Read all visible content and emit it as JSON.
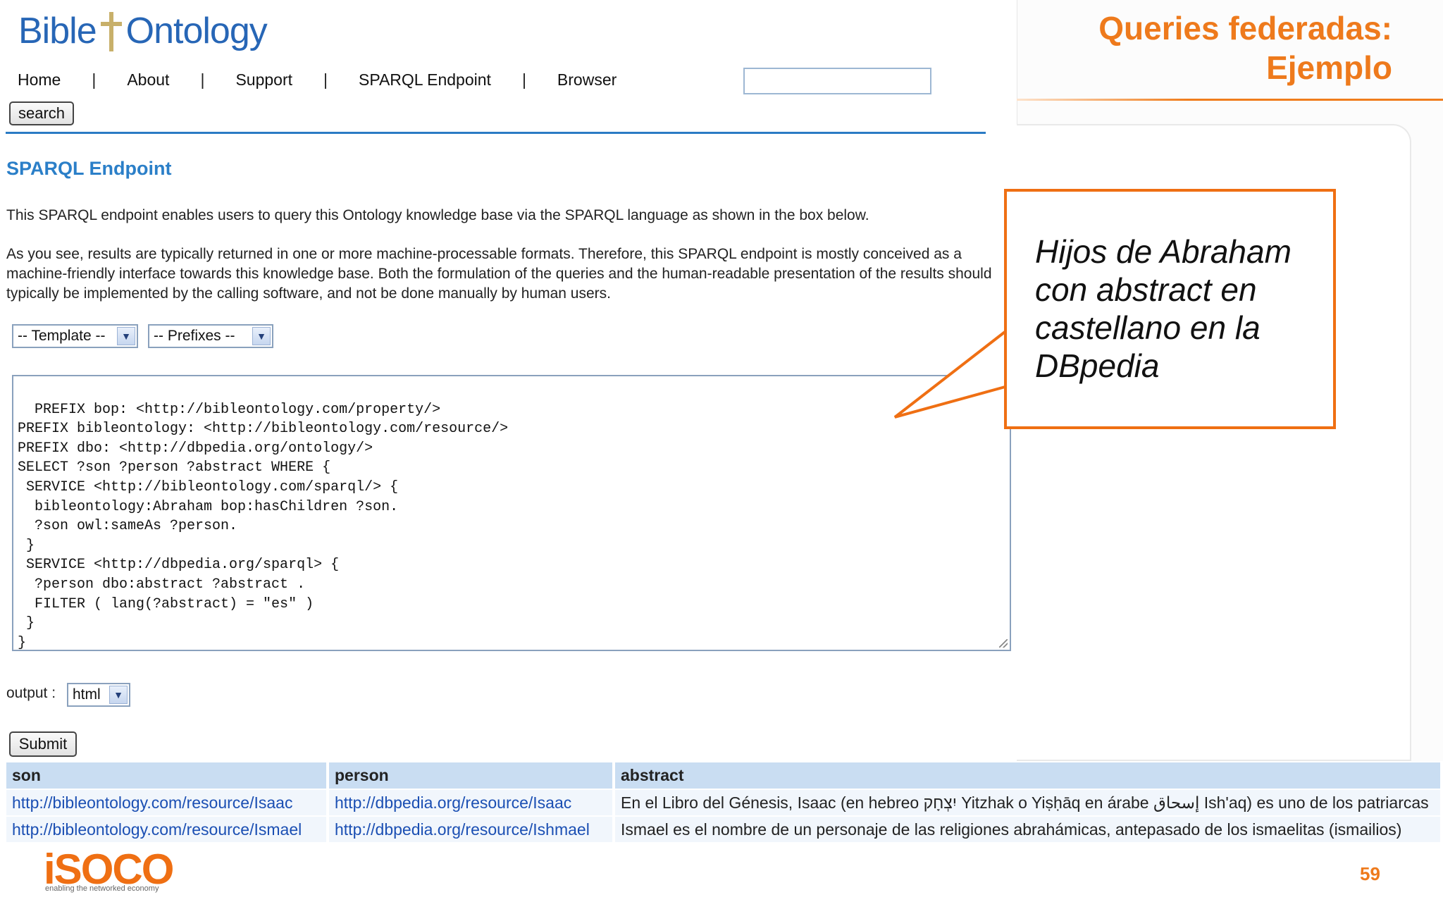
{
  "slide": {
    "title_line1": "Queries federadas:",
    "title_line2": "Ejemplo",
    "page_number": "59",
    "brand_logo": "iSOCO",
    "brand_tagline": "enabling the networked economy",
    "accent_color": "#ee7a1c"
  },
  "site": {
    "logo_left": "Bible",
    "logo_right": "Ontology",
    "nav": [
      "Home",
      "About",
      "Support",
      "SPARQL Endpoint",
      "Browser"
    ],
    "nav_separator": "|",
    "search_value": "",
    "search_button": "search",
    "heading": "SPARQL Endpoint",
    "paragraph1": "This SPARQL endpoint enables users to query this Ontology knowledge base via the SPARQL language as shown in the box below.",
    "paragraph2": "As you see, results are typically returned in one or more machine-processable formats. Therefore, this SPARQL endpoint is mostly conceived as a machine-friendly interface towards this knowledge base. Both the formulation of the queries and the human-readable presentation of the results should typically be implemented by the calling software, and not be done manually by human users.",
    "template_select": "-- Template --",
    "prefixes_select": "-- Prefixes --",
    "query": "PREFIX bop: <http://bibleontology.com/property/>\nPREFIX bibleontology: <http://bibleontology.com/resource/>\nPREFIX dbo: <http://dbpedia.org/ontology/>\nSELECT ?son ?person ?abstract WHERE {\n SERVICE <http://bibleontology.com/sparql/> {\n  bibleontology:Abraham bop:hasChildren ?son.\n  ?son owl:sameAs ?person.\n }\n SERVICE <http://dbpedia.org/sparql> {\n  ?person dbo:abstract ?abstract .\n  FILTER ( lang(?abstract) = \"es\" )\n }\n}",
    "output_label": "output :",
    "output_select": "html",
    "submit_button": "Submit"
  },
  "results": {
    "headers": [
      "son",
      "person",
      "abstract"
    ],
    "rows": [
      [
        "http://bibleontology.com/resource/Isaac",
        "http://dbpedia.org/resource/Isaac",
        "En el Libro del Génesis, Isaac (en hebreo יִצְחָק Yitzhak o Yiṣḥāq en árabe إسحاق Ish'aq) es uno de los patriarcas"
      ],
      [
        "http://bibleontology.com/resource/Ismael",
        "http://dbpedia.org/resource/Ishmael",
        "Ismael es el nombre de un personaje de las religiones abrahámicas, antepasado de los ismaelitas (ismailios)"
      ]
    ]
  },
  "callout": {
    "text": "Hijos de Abraham con abstract en castellano en la DBpedia"
  }
}
